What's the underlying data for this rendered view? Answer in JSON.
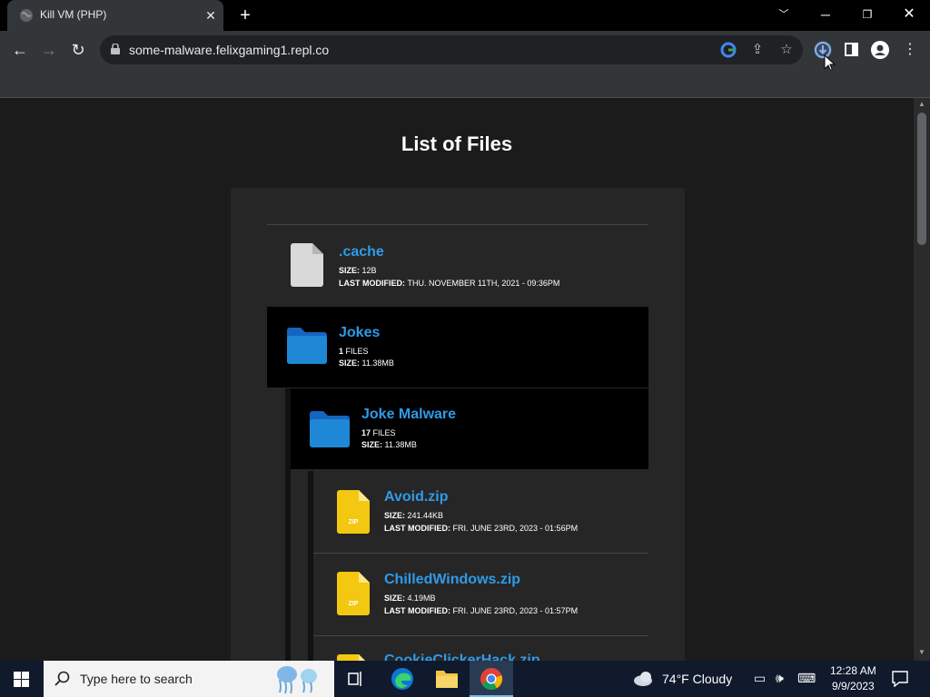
{
  "browser": {
    "tab_title": "Kill VM (PHP)",
    "url": "some-malware.felixgaming1.repl.co"
  },
  "page": {
    "title": "List of Files",
    "entries": [
      {
        "name": ".cache",
        "type": "file",
        "line1_label": "SIZE:",
        "line1_value": "12B",
        "line2_label": "LAST MODIFIED:",
        "line2_value": "THU. NOVEMBER 11TH, 2021 - 09:36PM"
      },
      {
        "name": "Jokes",
        "type": "folder",
        "line1_label": "1",
        "line1_value": "FILES",
        "line2_label": "SIZE:",
        "line2_value": "11.38MB"
      },
      {
        "name": "Joke Malware",
        "type": "folder",
        "line1_label": "17",
        "line1_value": "FILES",
        "line2_label": "SIZE:",
        "line2_value": "11.38MB"
      },
      {
        "name": "Avoid.zip",
        "type": "zip",
        "line1_label": "SIZE:",
        "line1_value": "241.44KB",
        "line2_label": "LAST MODIFIED:",
        "line2_value": "FRI. JUNE 23RD, 2023 - 01:56PM"
      },
      {
        "name": "ChilledWindows.zip",
        "type": "zip",
        "line1_label": "SIZE:",
        "line1_value": "4.19MB",
        "line2_label": "LAST MODIFIED:",
        "line2_value": "FRI. JUNE 23RD, 2023 - 01:57PM"
      },
      {
        "name": "CookieClickerHack.zip",
        "type": "zip"
      }
    ],
    "zip_badge": "ZIP"
  },
  "taskbar": {
    "search_placeholder": "Type here to search",
    "weather": "74°F  Cloudy",
    "time": "12:28 AM",
    "date": "9/9/2023"
  },
  "colors": {
    "link": "#2f9be8",
    "folder": "#1e88d6",
    "zip": "#f2c811"
  }
}
